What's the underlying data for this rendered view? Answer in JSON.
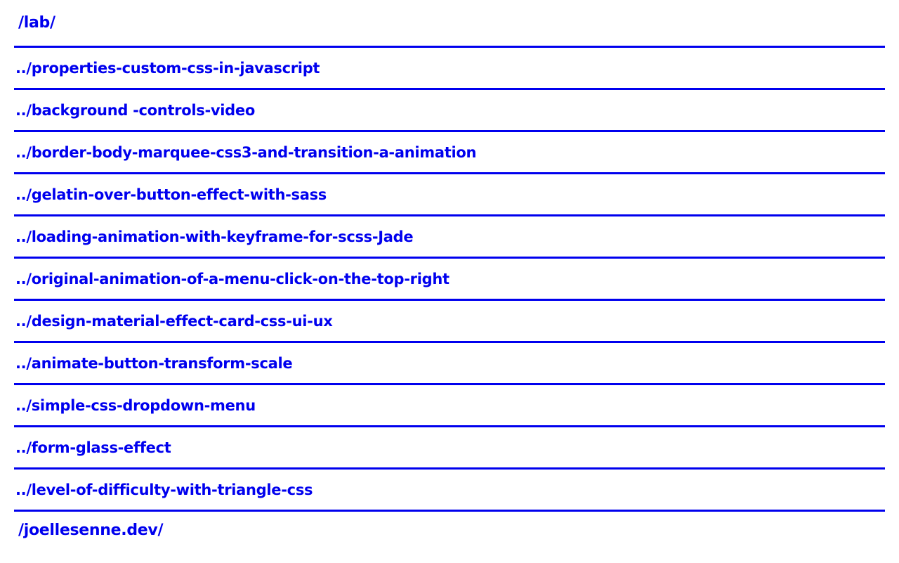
{
  "colors": {
    "link": "#0000ee",
    "divider": "#0000ee",
    "background": "#ffffff"
  },
  "header": {
    "link_label": "/lab/"
  },
  "items": [
    {
      "label": "../properties-custom-css-in-javascript"
    },
    {
      "label": "../background -controls-video"
    },
    {
      "label": "../border-body-marquee-css3-and-transition-a-animation"
    },
    {
      "label": "../gelatin-over-button-effect-with-sass"
    },
    {
      "label": "../loading-animation-with-keyframe-for-scss-Jade"
    },
    {
      "label": "../original-animation-of-a-menu-click-on-the-top-right"
    },
    {
      "label": "../design-material-effect-card-css-ui-ux"
    },
    {
      "label": "../animate-button-transform-scale"
    },
    {
      "label": "../simple-css-dropdown-menu"
    },
    {
      "label": "../form-glass-effect"
    },
    {
      "label": "../level-of-difficulty-with-triangle-css"
    }
  ],
  "footer": {
    "link_label": "/joellesenne.dev/"
  }
}
